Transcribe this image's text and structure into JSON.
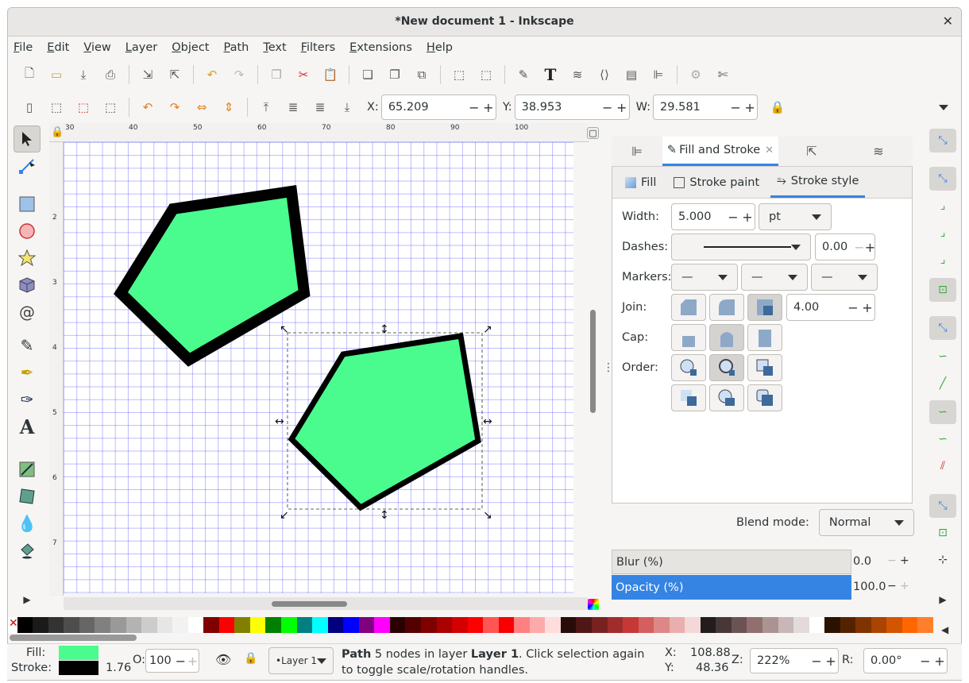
{
  "title": "*New document 1 - Inkscape",
  "menu": [
    "File",
    "Edit",
    "View",
    "Layer",
    "Object",
    "Path",
    "Text",
    "Filters",
    "Extensions",
    "Help"
  ],
  "toolbar": {
    "x_label": "X:",
    "x": "65.209",
    "y_label": "Y:",
    "y": "38.953",
    "w_label": "W:",
    "w": "29.581"
  },
  "ruler_h": [
    "30",
    "40",
    "50",
    "60",
    "70",
    "80",
    "90",
    "100"
  ],
  "ruler_v": [
    "2",
    "3",
    "4",
    "5",
    "6",
    "7"
  ],
  "dialog": {
    "tab_label": "Fill and Stroke",
    "sub_fill": "Fill",
    "sub_stroke_paint": "Stroke paint",
    "sub_stroke_style": "Stroke style",
    "width_label": "Width:",
    "width": "5.000",
    "unit": "pt",
    "dashes_label": "Dashes:",
    "dash_offset": "0.00",
    "markers_label": "Markers:",
    "join_label": "Join:",
    "miter": "4.00",
    "cap_label": "Cap:",
    "order_label": "Order:",
    "blend_label": "Blend mode:",
    "blend": "Normal",
    "blur_label": "Blur (%)",
    "blur": "0.0",
    "opacity_label": "Opacity (%)",
    "opacity": "100.0"
  },
  "status": {
    "fill_label": "Fill:",
    "stroke_label": "Stroke:",
    "stroke_width": "1.76",
    "o_label": "O:",
    "o_value": "100",
    "layer": "•Layer 1",
    "msg_prefix": "Path",
    "msg_bold1": "5 nodes in layer",
    "msg_bold2": "Layer 1",
    "msg_rest": ". Click selection again to toggle scale/rotation handles.",
    "x_label": "X:",
    "x": "108.88",
    "y_label": "Y:",
    "y": "48.36",
    "z_label": "Z:",
    "zoom": "222%",
    "r_label": "R:",
    "rotation": "0.00°"
  },
  "colors": {
    "shape_fill": "#4afc8d",
    "accent": "#3584e4",
    "shape_stroke": "#000000"
  }
}
